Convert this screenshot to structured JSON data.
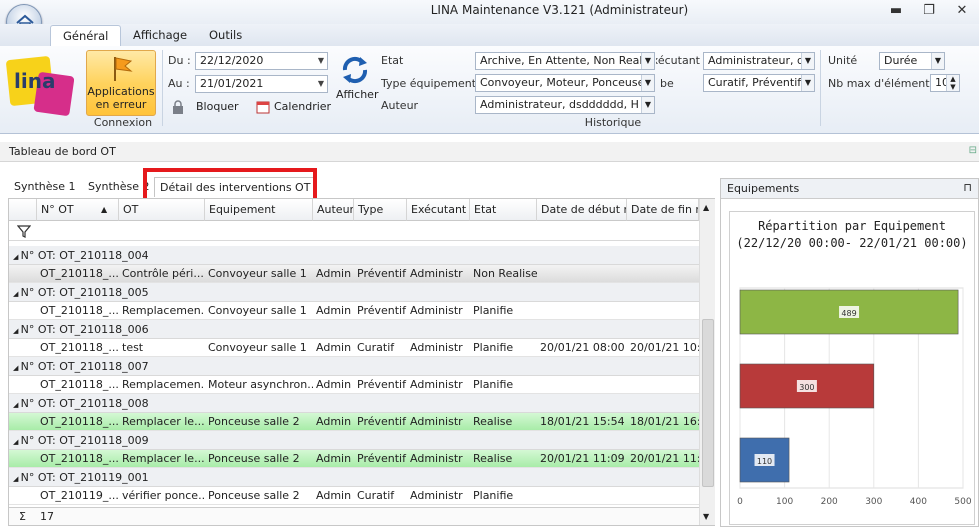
{
  "window": {
    "title": "LINA Maintenance  V3.121  (Administrateur)"
  },
  "ribbon_tabs": [
    "Général",
    "Affichage",
    "Outils"
  ],
  "connexion": {
    "button_label": "Applications en erreur",
    "group_title": "Connexion"
  },
  "dates": {
    "du_label": "Du :",
    "du_value": "22/12/2020",
    "au_label": "Au :",
    "au_value": "21/01/2021",
    "bloquer_label": "Bloquer",
    "calendrier_label": "Calendrier"
  },
  "afficher_label": "Afficher",
  "historique": {
    "group_title": "Historique",
    "etat_label": "Etat",
    "etat_value": "Archive,  En Attente,  Non Realise",
    "type_label": "Type équipement",
    "type_value": "Convoyeur,  Moteur,  Ponceuse",
    "auteur_label": "Auteur",
    "auteur_value": "Administrateur,  dsdddddd,  H I",
    "executant_label": "Exécutant",
    "executant_value": "Administrateur,  ds",
    "ot_type_label": "be",
    "ot_type_value": "Curatif,  Préventif"
  },
  "options": {
    "unite_label": "Unité",
    "unite_value": "Durée",
    "nbmax_label": "Nb max d'éléments",
    "nbmax_value": "10"
  },
  "dashboard": {
    "title": "Tableau de bord OT"
  },
  "doc_tabs": [
    "Synthèse 1",
    "Synthèse 2",
    "Détail des interventions OT"
  ],
  "grid": {
    "headers": [
      "N° OT",
      "OT",
      "Equipement",
      "Auteur",
      "Type",
      "Exécutant",
      "Etat",
      "Date de début ré",
      "Date de fin rée"
    ],
    "group_prefix": "N° OT:",
    "groups": [
      {
        "key": "OT_210118_004",
        "row": {
          "no": "OT_210118_...",
          "ot": "Contrôle péri...",
          "eq": "Convoyeur salle 1",
          "auteur": "Admin",
          "type": "Préventif",
          "exec": "Administr",
          "etat": "Non Realise",
          "debut": "",
          "fin": "",
          "style": "sel"
        }
      },
      {
        "key": "OT_210118_005",
        "row": {
          "no": "OT_210118_...",
          "ot": "Remplacemen...",
          "eq": "Convoyeur salle 1",
          "auteur": "Admin",
          "type": "Préventif",
          "exec": "Administr",
          "etat": "Planifie",
          "debut": "",
          "fin": "",
          "style": ""
        }
      },
      {
        "key": "OT_210118_006",
        "row": {
          "no": "OT_210118_...",
          "ot": "test",
          "eq": "Convoyeur salle 1",
          "auteur": "Admin",
          "type": "Curatif",
          "exec": "Administr",
          "etat": "Planifie",
          "debut": "20/01/21 08:00",
          "fin": "20/01/21 10:45:",
          "style": ""
        }
      },
      {
        "key": "OT_210118_007",
        "row": {
          "no": "OT_210118_...",
          "ot": "Remplacemen...",
          "eq": "Moteur asynchron...",
          "auteur": "Admin",
          "type": "Préventif",
          "exec": "Administr",
          "etat": "Planifie",
          "debut": "",
          "fin": "",
          "style": ""
        }
      },
      {
        "key": "OT_210118_008",
        "row": {
          "no": "OT_210118_...",
          "ot": "Remplacer le...",
          "eq": "Ponceuse salle 2",
          "auteur": "Admin",
          "type": "Préventif",
          "exec": "Administr",
          "etat": "Realise",
          "debut": "18/01/21 15:54",
          "fin": "18/01/21 16:54:",
          "style": "green"
        }
      },
      {
        "key": "OT_210118_009",
        "row": {
          "no": "OT_210118_...",
          "ot": "Remplacer le...",
          "eq": "Ponceuse salle 2",
          "auteur": "Admin",
          "type": "Préventif",
          "exec": "Administr",
          "etat": "Realise",
          "debut": "20/01/21 11:09",
          "fin": "20/01/21 11:29:",
          "style": "green"
        }
      },
      {
        "key": "OT_210119_001",
        "row": {
          "no": "OT_210119_...",
          "ot": "vérifier ponce...",
          "eq": "Ponceuse salle 2",
          "auteur": "Admin",
          "type": "Curatif",
          "exec": "Administr",
          "etat": "Planifie",
          "debut": "",
          "fin": "",
          "style": ""
        }
      }
    ],
    "sum_symbol": "Σ",
    "total": "17"
  },
  "right_panel": {
    "title": "Equipements"
  },
  "chart_data": {
    "type": "bar",
    "orientation": "horizontal",
    "title": "Répartition par Equipement",
    "subtitle": "(22/12/20 00:00- 22/01/21 00:00)",
    "values": [
      489,
      300,
      110
    ],
    "colors": [
      "#8db645",
      "#b83a3a",
      "#3f6ead"
    ],
    "xlim": [
      0,
      500
    ],
    "ticks": [
      0,
      100,
      200,
      300,
      400,
      500
    ]
  },
  "colors": {
    "accent": "#ffd35e",
    "highlight": "#e5191c",
    "realise_row": "#b6efb6"
  }
}
